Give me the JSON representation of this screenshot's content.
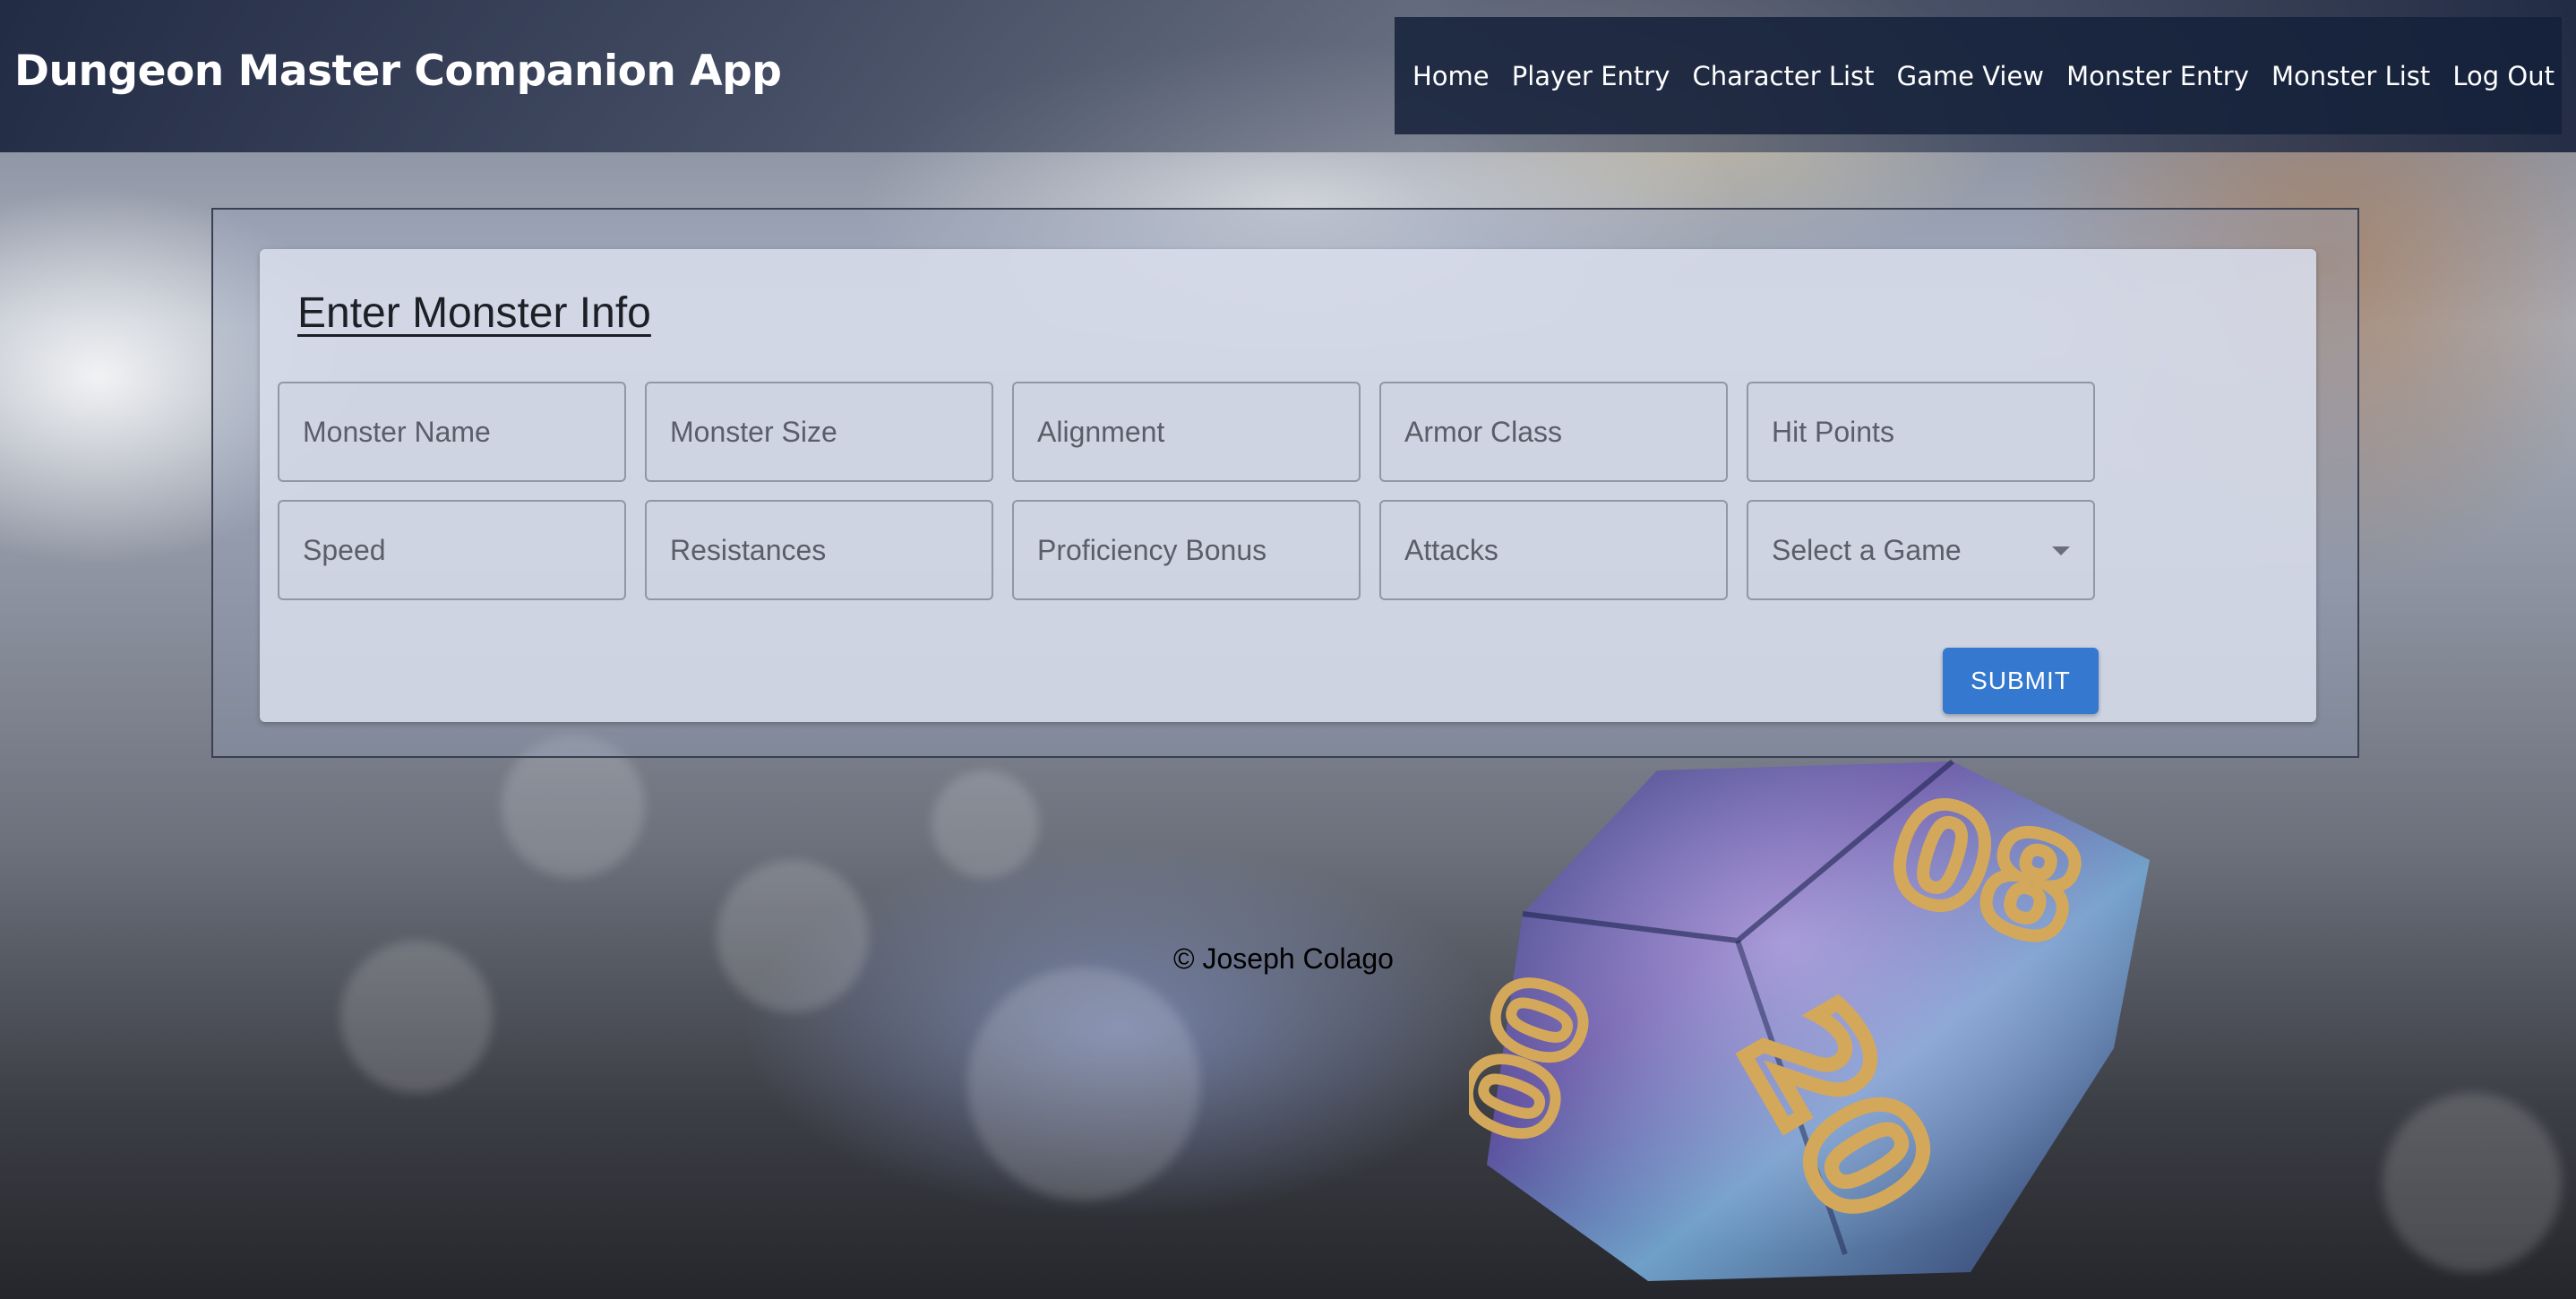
{
  "header": {
    "title": "Dungeon Master Companion App"
  },
  "nav": {
    "items": [
      {
        "label": "Home"
      },
      {
        "label": "Player Entry"
      },
      {
        "label": "Character List"
      },
      {
        "label": "Game View"
      },
      {
        "label": "Monster Entry"
      },
      {
        "label": "Monster List"
      },
      {
        "label": "Log Out"
      }
    ]
  },
  "form": {
    "title": "Enter Monster Info",
    "fields": [
      {
        "placeholder": "Monster Name",
        "value": ""
      },
      {
        "placeholder": "Monster Size",
        "value": ""
      },
      {
        "placeholder": "Alignment",
        "value": ""
      },
      {
        "placeholder": "Armor Class",
        "value": ""
      },
      {
        "placeholder": "Hit Points",
        "value": ""
      },
      {
        "placeholder": "Speed",
        "value": ""
      },
      {
        "placeholder": "Resistances",
        "value": ""
      },
      {
        "placeholder": "Proficiency Bonus",
        "value": ""
      },
      {
        "placeholder": "Attacks",
        "value": ""
      }
    ],
    "game_select": {
      "selected": "Select a Game"
    },
    "submit_label": "SUBMIT"
  },
  "footer": {
    "text": "© Joseph Colago"
  },
  "background": {
    "dice_numbers": [
      "08",
      "20",
      "00"
    ]
  },
  "colors": {
    "accent": "#3478d0",
    "header_bg": "#14203a"
  }
}
